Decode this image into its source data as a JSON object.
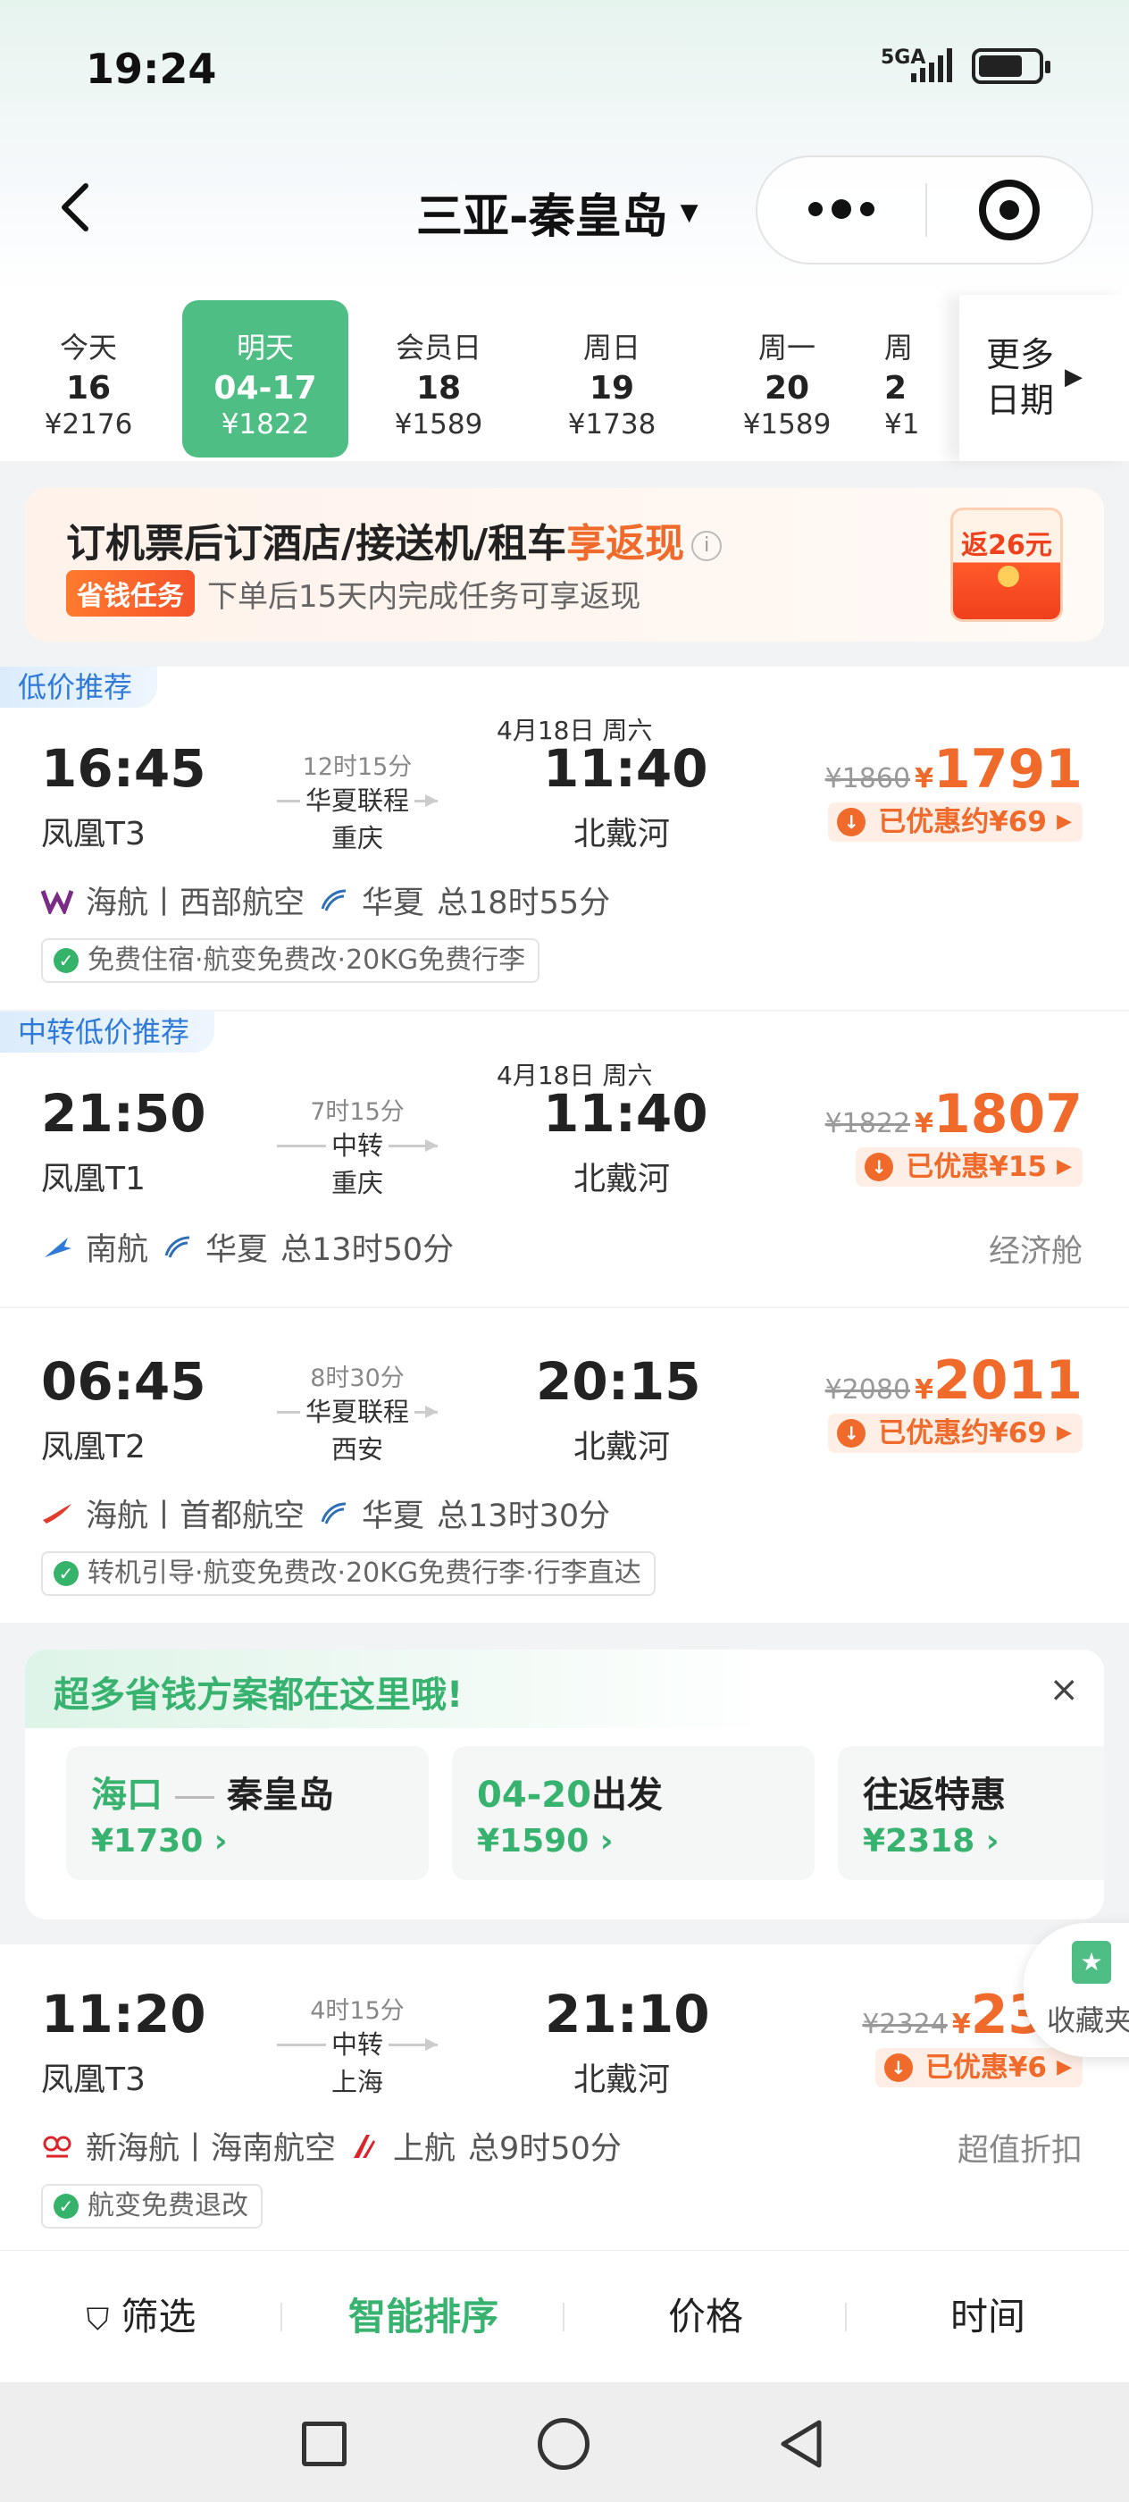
{
  "status_bar": {
    "time": "19:24",
    "network": "5GA",
    "battery_level": 0.75
  },
  "header": {
    "title": "三亚-秦皇岛",
    "caret": "▼",
    "more_icon": "more-dots-icon",
    "target_icon": "target-icon"
  },
  "dates": [
    {
      "label": "今天",
      "day": "16",
      "price": "¥2176",
      "active": false
    },
    {
      "label": "明天",
      "day": "04-17",
      "price": "¥1822",
      "active": true
    },
    {
      "label": "会员日",
      "day": "18",
      "price": "¥1589",
      "active": false
    },
    {
      "label": "周日",
      "day": "19",
      "price": "¥1738",
      "active": false
    },
    {
      "label": "周一",
      "day": "20",
      "price": "¥1589",
      "active": false
    },
    {
      "label": "周",
      "day": "2",
      "price": "¥1",
      "active": false
    }
  ],
  "date_more": {
    "line1": "更多",
    "line2": "日期"
  },
  "promo": {
    "title_prefix": "订机票后订酒店/接送机/租车",
    "title_highlight": "享返现",
    "info": "i",
    "tag": "省钱任务",
    "subtitle": "下单后15天内完成任务可享返现",
    "envelope": "返26元"
  },
  "flights": [
    {
      "tag": "低价推荐",
      "dep_time": "16:45",
      "dep_airport": "凤凰T3",
      "duration": "12时15分",
      "badge": "华夏联程",
      "via": "重庆",
      "arr_date": "4月18日 周六",
      "arr_time": "11:40",
      "arr_airport": "北戴河",
      "orig_price": "¥1860",
      "currency": "¥",
      "price": "1791",
      "discount": "已优惠约¥69",
      "airlines": "海航丨西部航空",
      "airline2": "华夏",
      "total": "总18时55分",
      "cabin": "",
      "perks": "免费住宿·航变免费改·20KG免费行李"
    },
    {
      "tag": "中转低价推荐",
      "dep_time": "21:50",
      "dep_airport": "凤凰T1",
      "duration": "7时15分",
      "badge": "中转",
      "via": "重庆",
      "arr_date": "4月18日 周六",
      "arr_time": "11:40",
      "arr_airport": "北戴河",
      "orig_price": "¥1822",
      "currency": "¥",
      "price": "1807",
      "discount": "已优惠¥15",
      "airlines": "南航",
      "airline2": "华夏",
      "total": "总13时50分",
      "cabin": "经济舱",
      "perks": ""
    },
    {
      "tag": "",
      "dep_time": "06:45",
      "dep_airport": "凤凰T2",
      "duration": "8时30分",
      "badge": "华夏联程",
      "via": "西安",
      "arr_date": "",
      "arr_time": "20:15",
      "arr_airport": "北戴河",
      "orig_price": "¥2080",
      "currency": "¥",
      "price": "2011",
      "discount": "已优惠约¥69",
      "airlines": "海航丨首都航空",
      "airline2": "华夏",
      "total": "总13时30分",
      "cabin": "",
      "perks": "转机引导·航变免费改·20KG免费行李·行李直达"
    },
    {
      "tag": "",
      "dep_time": "11:20",
      "dep_airport": "凤凰T3",
      "duration": "4时15分",
      "badge": "中转",
      "via": "上海",
      "arr_date": "",
      "arr_time": "21:10",
      "arr_airport": "北戴河",
      "orig_price": "¥2324",
      "currency": "¥",
      "price": "231",
      "discount": "已优惠¥6",
      "airlines": "新海航丨海南航空",
      "airline2": "上航",
      "total": "总9时50分",
      "cabin": "超值折扣",
      "perks": "航变免费退改"
    }
  ],
  "savings": {
    "title": "超多省钱方案都在这里哦!",
    "close": "×",
    "cards": [
      {
        "from": "海口",
        "to": "秦皇岛",
        "price": "¥1730 ›"
      },
      {
        "date": "04-20",
        "suffix": "出发",
        "price": "¥1590 ›"
      },
      {
        "title": "往返特惠",
        "price": "¥2318 ›"
      }
    ]
  },
  "favorite": {
    "label": "收藏夹"
  },
  "sortbar": {
    "filter": "筛选",
    "smart": "智能排序",
    "price": "价格",
    "time": "时间"
  },
  "colors": {
    "accent": "#4fbe84",
    "price": "#f06a2b",
    "tag_blue": "#2f7ad9"
  }
}
